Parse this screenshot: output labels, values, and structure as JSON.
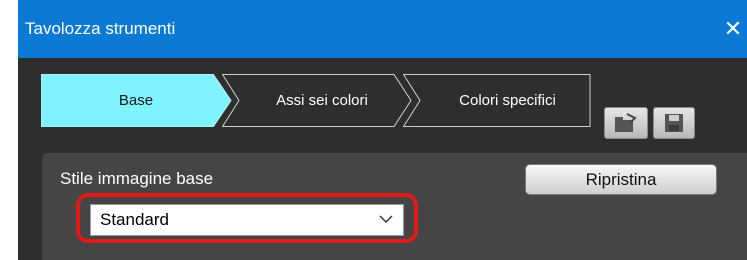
{
  "window": {
    "title": "Tavolozza strumenti",
    "close_symbol": "✕"
  },
  "tabs": [
    {
      "label": "Base",
      "active": true,
      "color": "#7ff3ff"
    },
    {
      "label": "Assi sei colori",
      "active": false
    },
    {
      "label": "Colori specifici",
      "active": false
    }
  ],
  "toolbar": {
    "icons": [
      "folder-refresh-icon",
      "save-icon"
    ]
  },
  "panel": {
    "section_label": "Stile immagine base",
    "reset_label": "Ripristina",
    "style_select": {
      "value": "Standard"
    }
  },
  "colors": {
    "titlebar": "#0c79d4",
    "active_tab": "#7ff3ff",
    "highlight": "#e11a1a"
  }
}
